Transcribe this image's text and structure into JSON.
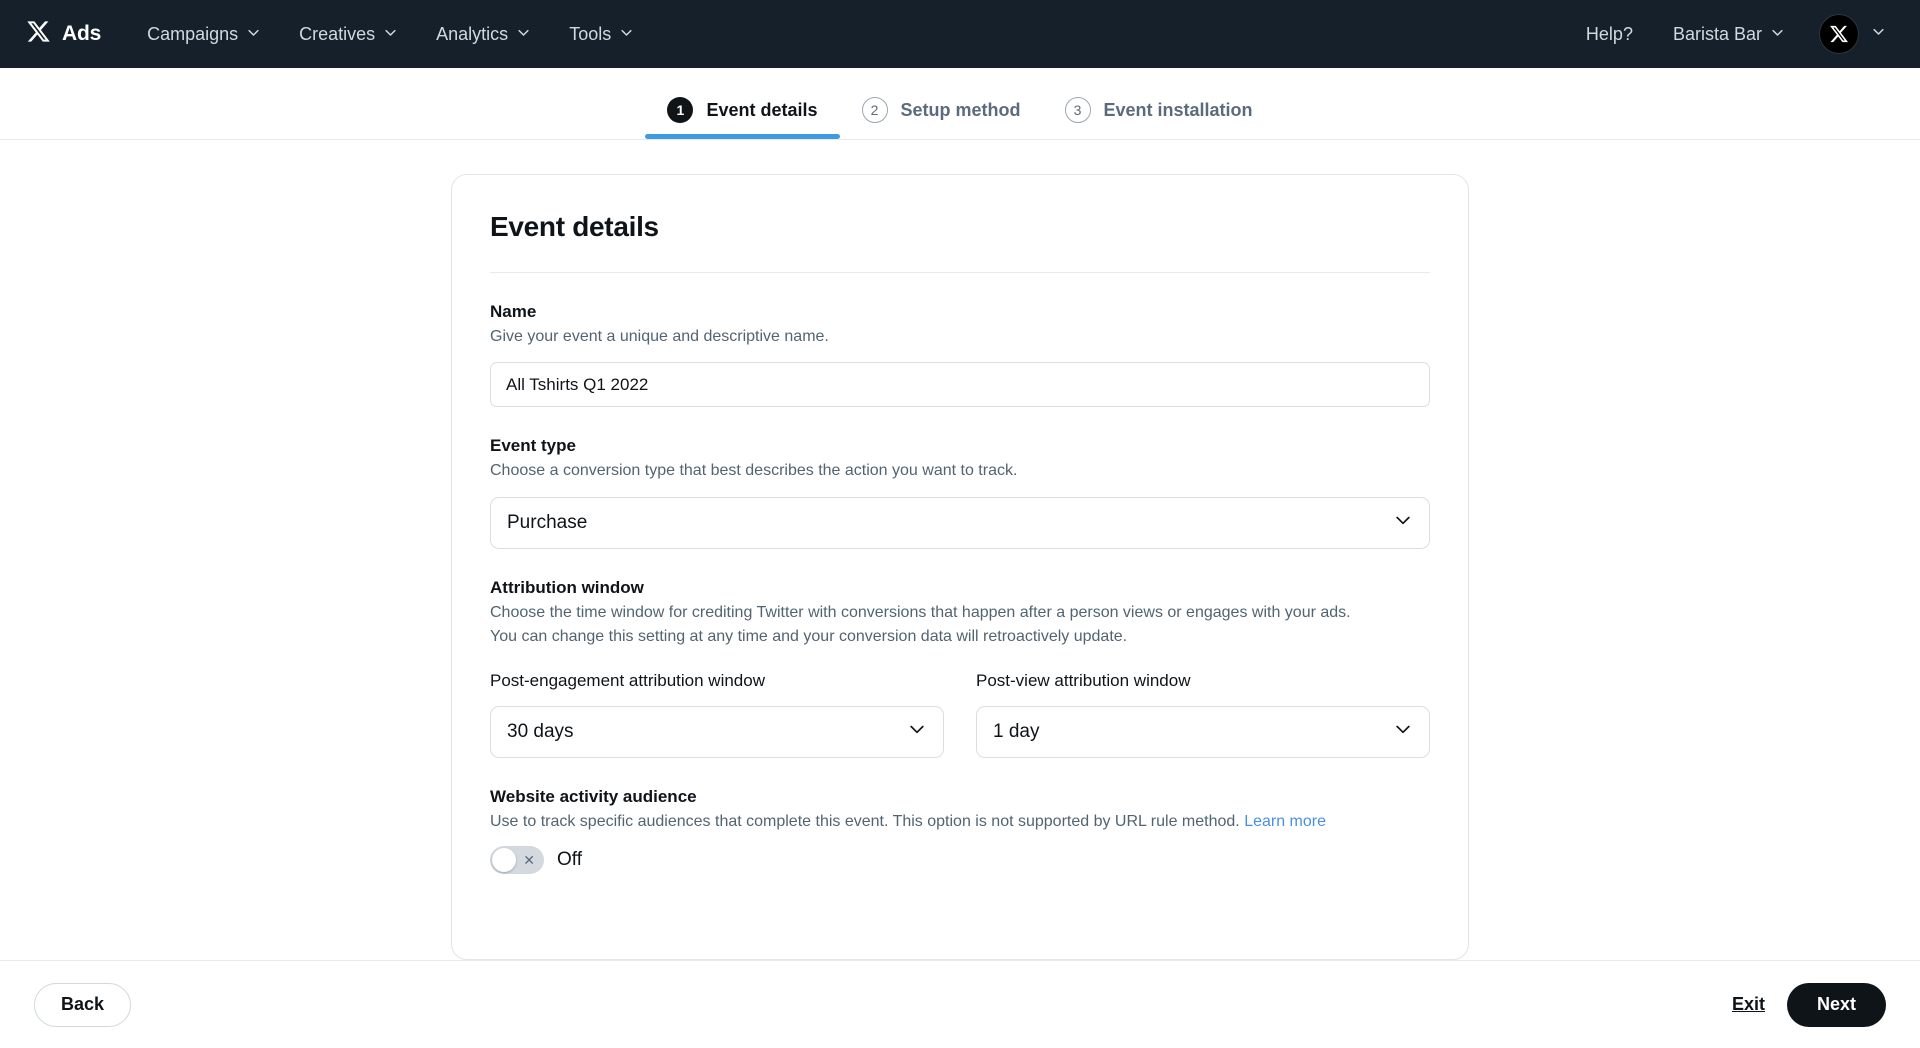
{
  "topbar": {
    "brand": "Ads",
    "logo_icon": "x-logo-icon",
    "nav": [
      {
        "label": "Campaigns",
        "icon": "chevron-down-icon"
      },
      {
        "label": "Creatives",
        "icon": "chevron-down-icon"
      },
      {
        "label": "Analytics",
        "icon": "chevron-down-icon"
      },
      {
        "label": "Tools",
        "icon": "chevron-down-icon"
      }
    ],
    "help": "Help?",
    "account": "Barista Bar",
    "account_icon": "chevron-down-icon",
    "avatar_icon": "x-avatar-icon",
    "avatar_caret_icon": "chevron-down-icon",
    "background": "#15202b"
  },
  "steps": [
    {
      "number": "1",
      "label": "Event details",
      "active": true
    },
    {
      "number": "2",
      "label": "Setup method",
      "active": false
    },
    {
      "number": "3",
      "label": "Event installation",
      "active": false
    }
  ],
  "accent_color": "#3f9ae4",
  "card": {
    "title": "Event details",
    "name": {
      "label": "Name",
      "help": "Give your event a unique and descriptive name.",
      "value": "All Tshirts Q1 2022",
      "placeholder": "Enter event name"
    },
    "event_type": {
      "label": "Event type",
      "help": "Choose a conversion type that best describes the action you want to track.",
      "value": "Purchase",
      "caret_icon": "chevron-down-icon"
    },
    "attribution": {
      "label": "Attribution window",
      "help_line1": "Choose the time window for crediting Twitter with conversions that happen after a person views or engages with your ads.",
      "help_line2": "You can change this setting at any time and your conversion data will retroactively update.",
      "post_engagement": {
        "label": "Post-engagement attribution window",
        "value": "30 days",
        "caret_icon": "chevron-down-icon"
      },
      "post_view": {
        "label": "Post-view attribution window",
        "value": "1 day",
        "caret_icon": "chevron-down-icon"
      }
    },
    "website_audience": {
      "label": "Website activity audience",
      "help": "Use to track specific audiences that complete this event. This option is not supported by URL rule method.",
      "learn_more": "Learn more",
      "toggle_state": "Off",
      "toggle_icon": "close-x-icon"
    }
  },
  "footer": {
    "back": "Back",
    "exit": "Exit",
    "next": "Next"
  }
}
